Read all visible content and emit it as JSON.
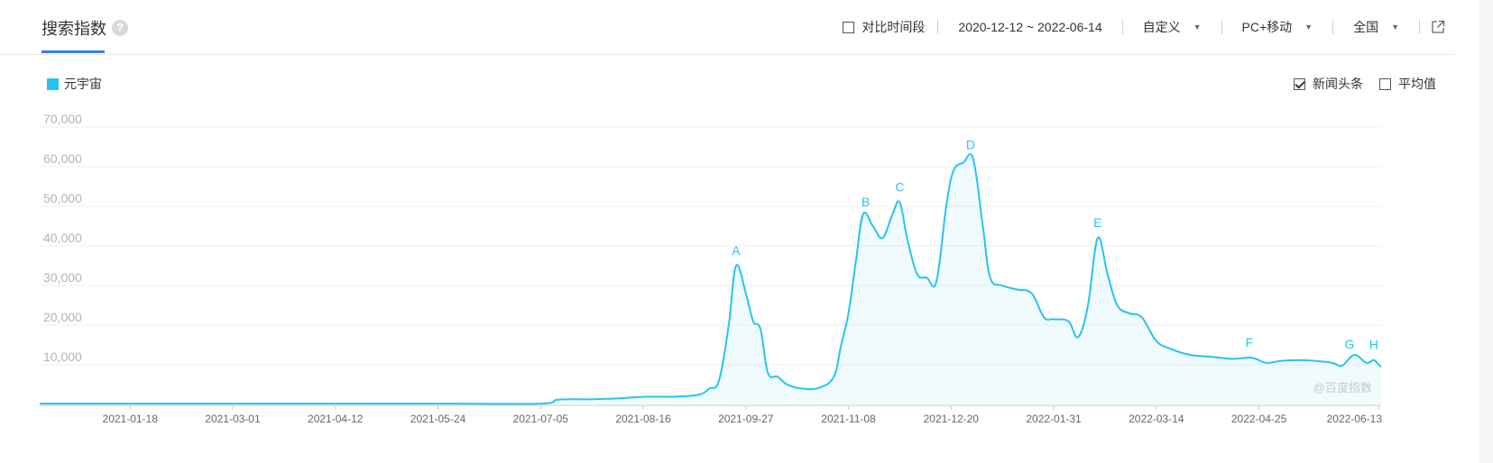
{
  "header": {
    "title": "搜索指数",
    "help_icon": "help-icon",
    "compare_label": "对比时间段",
    "date_range": "2020-12-12 ~ 2022-06-14",
    "period_select": "自定义",
    "device_select": "PC+移动",
    "region_select": "全国",
    "export_icon": "external-link-icon"
  },
  "options": {
    "news_label": "新闻头条",
    "news_checked": true,
    "avg_label": "平均值",
    "avg_checked": false
  },
  "watermark": "@百度指数",
  "colors": {
    "series": "#27c4f2",
    "accent": "#3380e6"
  },
  "chart_data": {
    "type": "area",
    "title": "",
    "xlabel": "",
    "ylabel": "",
    "ylim": [
      0,
      70000
    ],
    "yticks": [
      "10,000",
      "20,000",
      "30,000",
      "40,000",
      "50,000",
      "60,000",
      "70,000"
    ],
    "xticks": [
      "2021-01-18",
      "2021-03-01",
      "2021-04-12",
      "2021-05-24",
      "2021-07-05",
      "2021-08-16",
      "2021-09-27",
      "2021-11-08",
      "2021-12-20",
      "2022-01-31",
      "2022-03-14",
      "2022-04-25",
      "2022-06-13"
    ],
    "grid": true,
    "legend": "top-left",
    "series": [
      {
        "name": "元宇宙",
        "points": [
          [
            "2020-12-12",
            200
          ],
          [
            "2021-01-18",
            200
          ],
          [
            "2021-03-01",
            200
          ],
          [
            "2021-04-12",
            200
          ],
          [
            "2021-05-24",
            200
          ],
          [
            "2021-07-05",
            200
          ],
          [
            "2021-07-12",
            1200
          ],
          [
            "2021-07-25",
            1300
          ],
          [
            "2021-08-05",
            1500
          ],
          [
            "2021-08-16",
            1900
          ],
          [
            "2021-08-30",
            2000
          ],
          [
            "2021-09-08",
            2500
          ],
          [
            "2021-09-12",
            4000
          ],
          [
            "2021-09-16",
            6000
          ],
          [
            "2021-09-20",
            20000
          ],
          [
            "2021-09-23",
            35000
          ],
          [
            "2021-09-27",
            28000
          ],
          [
            "2021-09-30",
            21000
          ],
          [
            "2021-10-03",
            19000
          ],
          [
            "2021-10-06",
            8000
          ],
          [
            "2021-10-10",
            7000
          ],
          [
            "2021-10-14",
            5000
          ],
          [
            "2021-10-20",
            4000
          ],
          [
            "2021-10-27",
            4200
          ],
          [
            "2021-11-02",
            7000
          ],
          [
            "2021-11-05",
            15000
          ],
          [
            "2021-11-08",
            23000
          ],
          [
            "2021-11-11",
            36000
          ],
          [
            "2021-11-14",
            48000
          ],
          [
            "2021-11-18",
            45000
          ],
          [
            "2021-11-22",
            42000
          ],
          [
            "2021-11-26",
            48000
          ],
          [
            "2021-11-29",
            51000
          ],
          [
            "2021-12-02",
            42000
          ],
          [
            "2021-12-06",
            33000
          ],
          [
            "2021-12-10",
            32000
          ],
          [
            "2021-12-14",
            31000
          ],
          [
            "2021-12-18",
            50000
          ],
          [
            "2021-12-21",
            59000
          ],
          [
            "2021-12-25",
            61000
          ],
          [
            "2021-12-29",
            62000
          ],
          [
            "2022-01-02",
            45000
          ],
          [
            "2022-01-05",
            32000
          ],
          [
            "2022-01-10",
            30000
          ],
          [
            "2022-01-16",
            29000
          ],
          [
            "2022-01-22",
            28000
          ],
          [
            "2022-01-27",
            22000
          ],
          [
            "2022-01-31",
            21500
          ],
          [
            "2022-02-06",
            21000
          ],
          [
            "2022-02-10",
            17000
          ],
          [
            "2022-02-14",
            25000
          ],
          [
            "2022-02-18",
            42000
          ],
          [
            "2022-02-22",
            33000
          ],
          [
            "2022-02-26",
            25000
          ],
          [
            "2022-03-03",
            23000
          ],
          [
            "2022-03-08",
            22000
          ],
          [
            "2022-03-14",
            16000
          ],
          [
            "2022-03-20",
            14000
          ],
          [
            "2022-03-28",
            12500
          ],
          [
            "2022-04-06",
            12000
          ],
          [
            "2022-04-14",
            11500
          ],
          [
            "2022-04-22",
            11800
          ],
          [
            "2022-04-28",
            10500
          ],
          [
            "2022-05-04",
            11000
          ],
          [
            "2022-05-11",
            11200
          ],
          [
            "2022-05-18",
            11000
          ],
          [
            "2022-05-25",
            10500
          ],
          [
            "2022-05-29",
            9800
          ],
          [
            "2022-06-03",
            12500
          ],
          [
            "2022-06-08",
            10500
          ],
          [
            "2022-06-11",
            11200
          ],
          [
            "2022-06-13",
            10000
          ],
          [
            "2022-06-14",
            9500
          ]
        ]
      }
    ],
    "annotations": [
      {
        "label": "A",
        "x": "2021-09-23"
      },
      {
        "label": "B",
        "x": "2021-11-15"
      },
      {
        "label": "C",
        "x": "2021-11-29"
      },
      {
        "label": "D",
        "x": "2021-12-28"
      },
      {
        "label": "E",
        "x": "2022-02-18"
      },
      {
        "label": "F",
        "x": "2022-04-21"
      },
      {
        "label": "G",
        "x": "2022-06-01"
      },
      {
        "label": "H",
        "x": "2022-06-11"
      }
    ]
  }
}
